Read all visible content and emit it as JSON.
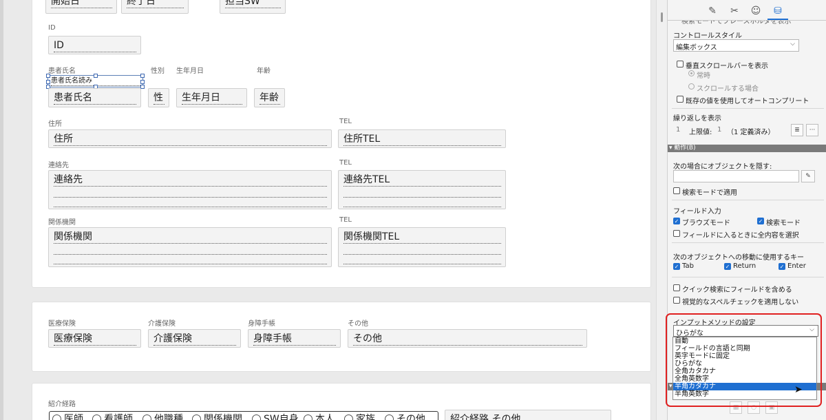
{
  "layout": {
    "top_fields": [
      "開始日",
      "終了日",
      "担当SW"
    ],
    "id_label": "ID",
    "id_field": "ID",
    "name_label": "患者氏名",
    "kana_field": "患者氏名読み",
    "name_field": "患者氏名",
    "gender_label": "性別",
    "gender_field": "性",
    "birth_label": "生年月日",
    "birth_field": "生年月日",
    "age_label": "年齢",
    "age_field": "年齢",
    "address_label": "住所",
    "address_field": "住所",
    "address_tel_label": "TEL",
    "address_tel_field": "住所TEL",
    "contact_label": "連絡先",
    "contact_field": "連絡先",
    "contact_tel_label": "TEL",
    "contact_tel_field": "連絡先TEL",
    "agency_label": "関係機関",
    "agency_field": "関係機関",
    "agency_tel_label": "TEL",
    "agency_tel_field": "関係機関TEL",
    "insurance": {
      "medical_label": "医療保険",
      "medical_field": "医療保険",
      "care_label": "介護保険",
      "care_field": "介護保険",
      "disability_label": "身障手帳",
      "disability_field": "身障手帳",
      "other_label": "その他",
      "other_field": "その他"
    },
    "referral_label": "紹介経路",
    "referral_options": [
      "医師",
      "看護師",
      "他職種",
      "関係機関",
      "SW自身",
      "本人",
      "家族",
      "その他"
    ],
    "referral_other_field": "紹介経路 その他"
  },
  "inspector": {
    "clipped_top_text": "検索モードでプレースホルダを表示",
    "control_style_label": "コントロールスタイル",
    "control_style_value": "編集ボックス",
    "vertical_scrollbar": "垂直スクロールバーを表示",
    "always": "常時",
    "when_scrolling": "スクロールする場合",
    "autocomplete": "既存の値を使用してオートコンプリート",
    "repeat_label": "繰り返しを表示",
    "repeat_from": "1",
    "upper_limit": "上限値:",
    "upper_value": "1",
    "defined_count": "（1 定義済み）",
    "behavior_header": "動作(B)",
    "hide_label": "次の場合にオブジェクトを隠す:",
    "apply_find_mode": "検索モードで適用",
    "field_entry_label": "フィールド入力",
    "browse_mode": "ブラウズモード",
    "find_mode": "検索モード",
    "select_all": "フィールドに入るときに全内容を選択",
    "next_object_label": "次のオブジェクトへの移動に使用するキー",
    "key_tab": "Tab",
    "key_return": "Return",
    "key_enter": "Enter",
    "quick_find": "クイック検索にフィールドを含める",
    "no_spellcheck": "視覚的なスペルチェックを適用しない",
    "input_method_label": "インプットメソッドの設定",
    "input_method_value": "ひらがな",
    "input_method_options": [
      "自動",
      "フィールドの言語と同期",
      "英字モードに固定",
      "ひらがな",
      "全角カタカナ",
      "全角英数字",
      "半角カタカナ",
      "半角英数字"
    ],
    "highlighted_option": "半角カタカナ"
  }
}
